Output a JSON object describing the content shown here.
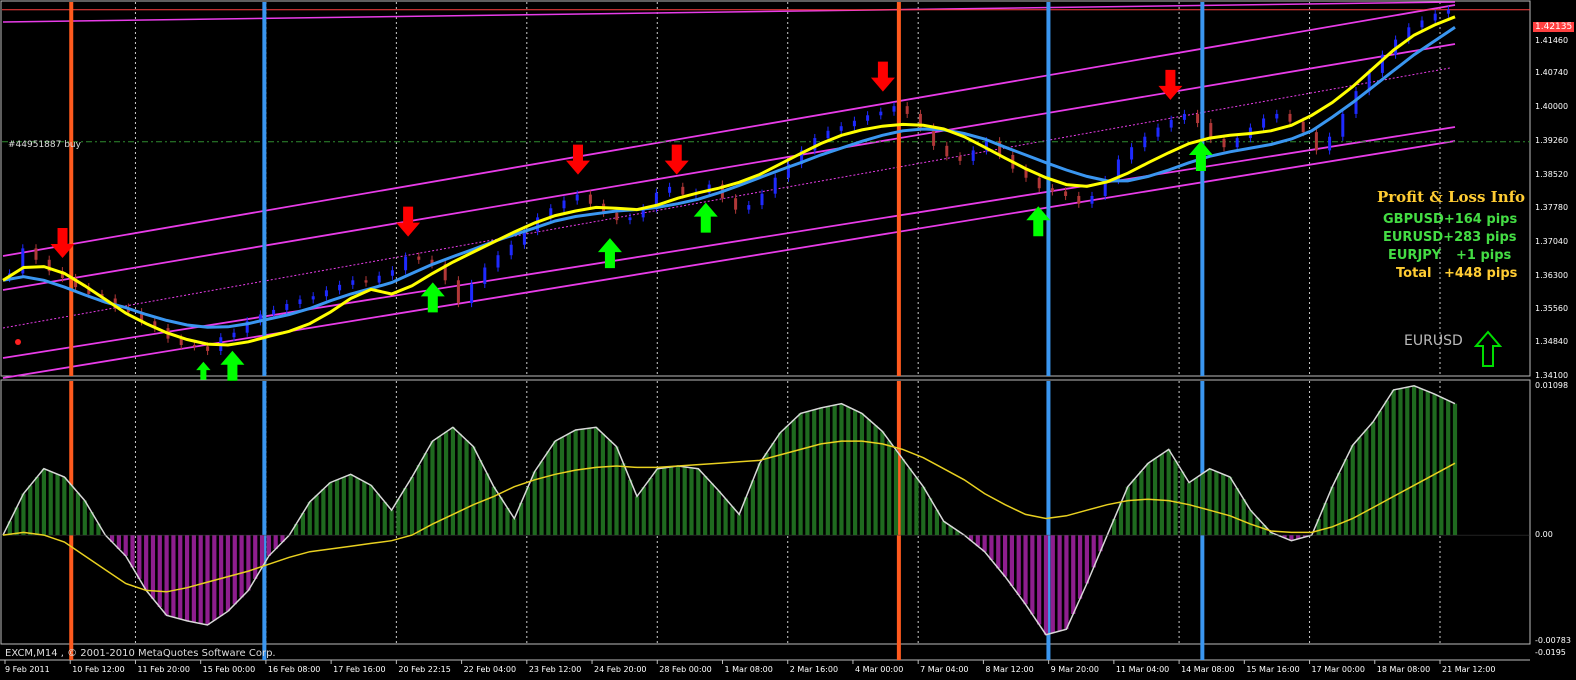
{
  "chart_data": [
    {
      "type": "candlestick",
      "symbol": "EURUSD",
      "order_label": "#44951887 buy",
      "y_ticks": [
        "1.42135",
        "1.41460",
        "1.40740",
        "1.40000",
        "1.39260",
        "1.38520",
        "1.37780",
        "1.37040",
        "1.36300",
        "1.35560",
        "1.34840",
        "1.34100"
      ],
      "ylim": [
        1.341,
        1.4213
      ],
      "current_price": 1.42135,
      "order_price": 1.3924,
      "series": [
        {
          "name": "",
          "kind": "close",
          "values": [
            1.3635,
            1.369,
            1.3665,
            1.364,
            1.3625,
            1.3605,
            1.359,
            1.358,
            1.356,
            1.355,
            1.353,
            1.3515,
            1.3492,
            1.3478,
            1.3475,
            1.3465,
            1.3495,
            1.3505,
            1.353,
            1.3545,
            1.3555,
            1.3568,
            1.3578,
            1.3585,
            1.3598,
            1.361,
            1.362,
            1.3615,
            1.363,
            1.3642,
            1.3672,
            1.3665,
            1.3655,
            1.362,
            1.357,
            1.3612,
            1.3648,
            1.3675,
            1.3698,
            1.3728,
            1.3758,
            1.3778,
            1.3795,
            1.3808,
            1.3788,
            1.3768,
            1.3752,
            1.3758,
            1.3778,
            1.3812,
            1.3825,
            1.3808,
            1.3812,
            1.383,
            1.38,
            1.3775,
            1.3785,
            1.381,
            1.3845,
            1.3875,
            1.3905,
            1.3932,
            1.3948,
            1.3958,
            1.397,
            1.3982,
            1.399,
            1.4002,
            1.3985,
            1.3955,
            1.3915,
            1.3892,
            1.3882,
            1.3905,
            1.3925,
            1.3895,
            1.3865,
            1.3845,
            1.3822,
            1.3815,
            1.3805,
            1.3788,
            1.3805,
            1.384,
            1.3885,
            1.3912,
            1.3935,
            1.3955,
            1.3972,
            1.3985,
            1.3965,
            1.393,
            1.3912,
            1.3932,
            1.3955,
            1.3975,
            1.3985,
            1.3968,
            1.3945,
            1.3905,
            1.3935,
            1.3985,
            1.4035,
            1.4075,
            1.4115,
            1.4148,
            1.4175,
            1.419,
            1.4205,
            1.4213
          ]
        },
        {
          "name": "",
          "kind": "fast-ma",
          "values": [
            1.362,
            1.3648,
            1.365,
            1.3635,
            1.3608,
            1.3578,
            1.3548,
            1.3525,
            1.3505,
            1.349,
            1.348,
            1.3478,
            1.3485,
            1.3497,
            1.3508,
            1.3525,
            1.355,
            1.358,
            1.36,
            1.359,
            1.3608,
            1.3635,
            1.366,
            1.3682,
            1.3704,
            1.3726,
            1.3746,
            1.3762,
            1.3772,
            1.378,
            1.3778,
            1.3775,
            1.3785,
            1.38,
            1.3812,
            1.3822,
            1.3835,
            1.3852,
            1.3875,
            1.3898,
            1.392,
            1.3938,
            1.395,
            1.3958,
            1.3962,
            1.396,
            1.3952,
            1.3935,
            1.3912,
            1.3888,
            1.3865,
            1.3845,
            1.383,
            1.3826,
            1.3836,
            1.3855,
            1.3878,
            1.39,
            1.392,
            1.3932,
            1.3938,
            1.3942,
            1.3948,
            1.396,
            1.3982,
            1.401,
            1.4045,
            1.4085,
            1.4125,
            1.4158,
            1.418,
            1.4198
          ]
        },
        {
          "name": "",
          "kind": "slow-ma",
          "values": [
            1.362,
            1.3628,
            1.362,
            1.3605,
            1.3588,
            1.3572,
            1.356,
            1.3545,
            1.3532,
            1.3522,
            1.3517,
            1.3518,
            1.3525,
            1.3535,
            1.3545,
            1.3558,
            1.3575,
            1.359,
            1.3602,
            1.3615,
            1.3635,
            1.3655,
            1.3672,
            1.3688,
            1.3705,
            1.372,
            1.3735,
            1.375,
            1.376,
            1.3766,
            1.3772,
            1.3775,
            1.378,
            1.3788,
            1.3798,
            1.3812,
            1.3828,
            1.3845,
            1.3862,
            1.3878,
            1.3895,
            1.391,
            1.3925,
            1.3938,
            1.3948,
            1.3952,
            1.395,
            1.3942,
            1.393,
            1.3912,
            1.3895,
            1.3878,
            1.3862,
            1.3848,
            1.3838,
            1.3838,
            1.3848,
            1.3862,
            1.3878,
            1.3892,
            1.3902,
            1.391,
            1.3918,
            1.393,
            1.3948,
            1.3978,
            1.401,
            1.4045,
            1.408,
            1.4115,
            1.4145,
            1.4175
          ]
        }
      ],
      "signals": [
        {
          "x": 0.041,
          "dir": "down"
        },
        {
          "x": 0.279,
          "dir": "down"
        },
        {
          "x": 0.396,
          "dir": "down"
        },
        {
          "x": 0.464,
          "dir": "down"
        },
        {
          "x": 0.606,
          "dir": "down"
        },
        {
          "x": 0.804,
          "dir": "down"
        },
        {
          "x": 0.138,
          "dir": "up",
          "small": true
        },
        {
          "x": 0.158,
          "dir": "up"
        },
        {
          "x": 0.296,
          "dir": "up"
        },
        {
          "x": 0.418,
          "dir": "up"
        },
        {
          "x": 0.484,
          "dir": "up"
        },
        {
          "x": 0.713,
          "dir": "up"
        },
        {
          "x": 0.825,
          "dir": "up"
        }
      ],
      "vertical_lines": [
        {
          "x": 0.047,
          "color": "#ff5a1e"
        },
        {
          "x": 0.18,
          "color": "#3a96f0"
        },
        {
          "x": 0.617,
          "color": "#ff5a1e"
        },
        {
          "x": 0.72,
          "color": "#3a96f0"
        },
        {
          "x": 0.826,
          "color": "#3a96f0"
        }
      ],
      "colors": {
        "bull": "#1e2aff",
        "bear": "#b03838",
        "fast_ma": "#ffff00",
        "slow_ma": "#3a96f0",
        "channel": "#e83ce8",
        "current": "#ff4040",
        "order": "#2f8c2f",
        "signal_up": "#00ff00",
        "signal_down": "#ff0000"
      }
    },
    {
      "type": "histogram",
      "y_ticks": [
        "0.01098",
        "0.00",
        "-0.00783",
        "-0.0195"
      ],
      "ylim": [
        -0.0078,
        0.011
      ],
      "series": [
        {
          "name": "",
          "kind": "histogram",
          "values": [
            0,
            0.003,
            0.0048,
            0.0042,
            0.0025,
            0,
            -0.0015,
            -0.004,
            -0.0058,
            -0.0062,
            -0.0065,
            -0.0055,
            -0.004,
            -0.0015,
            0,
            0.0024,
            0.0038,
            0.0044,
            0.0036,
            0.0018,
            0.0042,
            0.0068,
            0.0078,
            0.0064,
            0.0035,
            0.0012,
            0.0046,
            0.0068,
            0.0076,
            0.0078,
            0.0064,
            0.0028,
            0.0048,
            0.005,
            0.0048,
            0.0032,
            0.0015,
            0.0052,
            0.0074,
            0.0088,
            0.0092,
            0.0095,
            0.0088,
            0.0075,
            0.0055,
            0.0035,
            0.001,
            0,
            -0.0012,
            -0.003,
            -0.005,
            -0.0072,
            -0.0068,
            -0.0035,
            0,
            0.0035,
            0.0052,
            0.0062,
            0.0038,
            0.0048,
            0.0042,
            0.0018,
            0.0002,
            -0.0004,
            0,
            0.0035,
            0.0065,
            0.0082,
            0.0105,
            0.0108,
            0.0102,
            0.0095
          ]
        },
        {
          "name": "",
          "kind": "signal",
          "values": [
            0,
            0.0002,
            0,
            -0.0005,
            -0.0015,
            -0.0025,
            -0.0035,
            -0.004,
            -0.0041,
            -0.0038,
            -0.0034,
            -0.003,
            -0.0026,
            -0.0021,
            -0.0016,
            -0.0012,
            -0.001,
            -0.0008,
            -0.0006,
            -0.0004,
            0,
            0.0008,
            0.0015,
            0.0022,
            0.0028,
            0.0035,
            0.004,
            0.0044,
            0.0047,
            0.0049,
            0.005,
            0.0049,
            0.0049,
            0.005,
            0.0051,
            0.0052,
            0.0053,
            0.0054,
            0.0058,
            0.0062,
            0.0066,
            0.0068,
            0.0068,
            0.0066,
            0.0062,
            0.0056,
            0.0048,
            0.004,
            0.003,
            0.0022,
            0.0015,
            0.0012,
            0.0014,
            0.0018,
            0.0022,
            0.0025,
            0.0026,
            0.0025,
            0.0022,
            0.0018,
            0.0014,
            0.0008,
            0.0003,
            0.0002,
            0.0002,
            0.0006,
            0.0012,
            0.002,
            0.0028,
            0.0036,
            0.0044,
            0.0052
          ]
        }
      ],
      "colors": {
        "positive": "#1f6a1f",
        "negative": "#8e1e8e",
        "outline": "#d8d8d8",
        "signal": "#e8d020"
      }
    }
  ],
  "x_ticks": [
    "9 Feb 2011",
    "10 Feb 12:00",
    "11 Feb 20:00",
    "15 Feb 00:00",
    "16 Feb 08:00",
    "17 Feb 16:00",
    "20 Feb 22:15",
    "22 Feb 04:00",
    "23 Feb 12:00",
    "24 Feb 20:00",
    "28 Feb 00:00",
    "1 Mar 08:00",
    "2 Mar 16:00",
    "4 Mar 00:00",
    "7 Mar 04:00",
    "8 Mar 12:00",
    "9 Mar 20:00",
    "11 Mar 04:00",
    "14 Mar 08:00",
    "15 Mar 16:00",
    "17 Mar 00:00",
    "18 Mar 08:00",
    "21 Mar 12:00"
  ],
  "pnl": {
    "title": "Profit & Loss Info",
    "rows": [
      {
        "symbol": "GBPUSD",
        "value": "+164 pips"
      },
      {
        "symbol": "EURUSD",
        "value": "+283 pips"
      },
      {
        "symbol": "EURJPY",
        "value": "+1 pips"
      },
      {
        "symbol": "Total",
        "value": "+448 pips"
      }
    ],
    "colors": {
      "title": "#ffcc33",
      "row": "#44dd44",
      "total": "#ffcc33"
    }
  },
  "symbol_signal": {
    "label": "EURUSD",
    "icon": "up-outline-arrow-icon",
    "color": "#bbbbbb",
    "arrow_color": "#00dd00"
  },
  "footer": {
    "copyright": "EXCM,M14 , © 2001-2010 MetaQuotes Software Corp."
  }
}
